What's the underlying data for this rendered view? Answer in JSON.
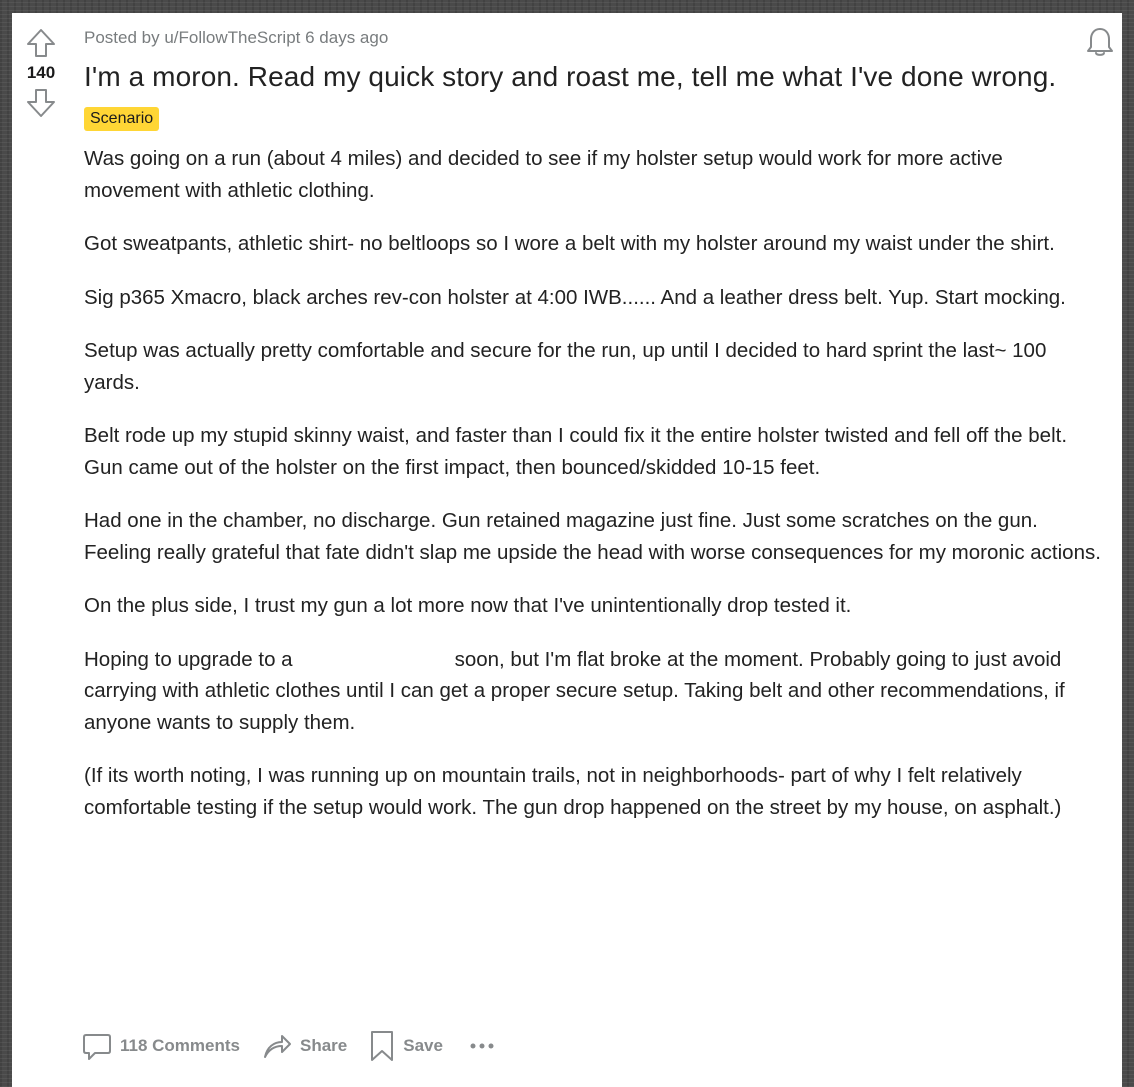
{
  "post": {
    "score": "140",
    "meta_prefix": "Posted by ",
    "author": "u/FollowTheScript",
    "age": " 6 days ago",
    "title": "I'm a moron. Read my quick story and roast me, tell me what I've done wrong.",
    "flair": "Scenario",
    "paragraphs": {
      "p1": "Was going on a run (about 4 miles) and decided to see if my holster setup would work for more active movement with athletic clothing.",
      "p2": "Got sweatpants, athletic shirt- no beltloops so I wore a belt with my holster around my waist under the shirt.",
      "p3": "Sig p365 Xmacro, black arches rev-con holster at 4:00 IWB...... And a leather dress belt. Yup. Start mocking.",
      "p4": "Setup was actually pretty comfortable and secure for the run, up until I decided to hard sprint the last~ 100 yards.",
      "p5": "Belt rode up my stupid skinny waist, and faster than I could fix it the entire holster twisted and fell off the belt. Gun came out of the holster on the first impact, then bounced/skidded 10-15 feet.",
      "p6": "Had one in the chamber, no discharge. Gun retained magazine just fine. Just some scratches on the gun. Feeling really grateful that fate didn't slap me upside the head with worse consequences for my moronic actions.",
      "p7": "On the plus side, I trust my gun a lot more now that I've unintentionally drop tested it.",
      "p8a": "Hoping to upgrade to a",
      "p8b": "soon, but I'm flat broke at the moment. Probably going to just avoid carrying with athletic clothes until I can get a proper secure setup. Taking belt and other recommendations, if anyone wants to supply them.",
      "p9": "(If its worth noting, I was running up on mountain trails, not in neighborhoods- part of why I felt relatively comfortable testing if the setup would work. The gun drop happened on the street by my house, on asphalt.)"
    }
  },
  "actions": {
    "comments": "118 Comments",
    "share": "Share",
    "save": "Save"
  },
  "icons": {
    "upvote": "upvote-arrow-icon",
    "downvote": "downvote-arrow-icon",
    "bell": "bell-icon",
    "comment": "comment-bubble-icon",
    "share": "share-arrow-icon",
    "save": "bookmark-icon",
    "more": "ellipsis-icon"
  },
  "colors": {
    "flair_bg": "#ffd635",
    "muted": "#878a8c",
    "text": "#222222"
  }
}
